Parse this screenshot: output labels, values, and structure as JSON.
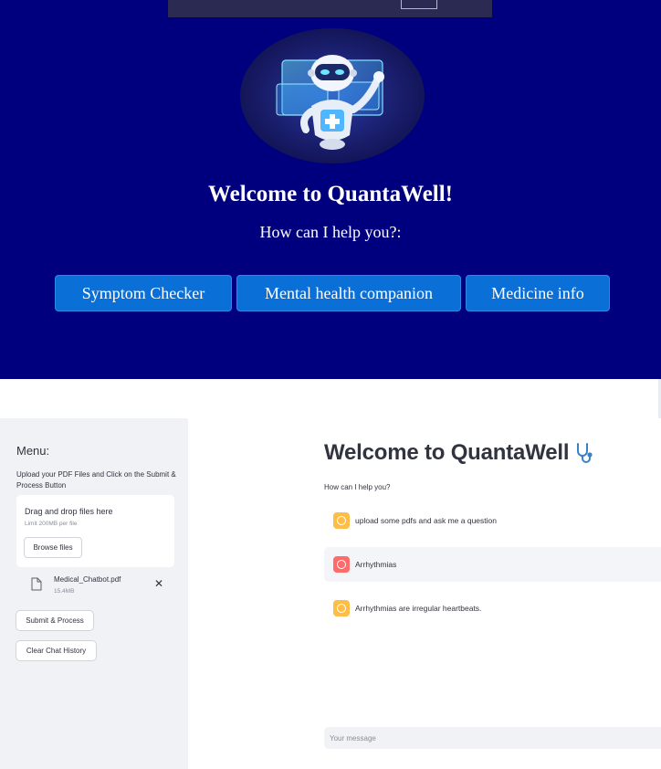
{
  "hero": {
    "title": "Welcome to QuantaWell!",
    "subtitle": "How can I help you?:",
    "buttons": [
      {
        "label": "Symptom Checker"
      },
      {
        "label": "Mental health companion"
      },
      {
        "label": "Medicine info"
      }
    ],
    "colors": {
      "background": "#00007f",
      "button": "#0b6fd8"
    }
  },
  "sidebar": {
    "menu_title": "Menu:",
    "description": "Upload your PDF Files and Click on the Submit & Process Button",
    "uploader": {
      "title": "Drag and drop files here",
      "limit": "Limit 200MB per file",
      "browse_label": "Browse files"
    },
    "file": {
      "name": "Medical_Chatbot.pdf",
      "size": "15.4MB",
      "remove_icon": "close-icon"
    },
    "submit_label": "Submit & Process",
    "clear_label": "Clear Chat History"
  },
  "chat": {
    "title": "Welcome to QuantaWell",
    "title_icon": "stethoscope-icon",
    "subtitle": "How can I help you?",
    "messages": [
      {
        "role": "assistant",
        "text": "upload some pdfs and ask me a question"
      },
      {
        "role": "user",
        "text": "Arrhythmias"
      },
      {
        "role": "assistant",
        "text": "Arrhythmias are irregular heartbeats."
      }
    ],
    "input_placeholder": "Your message",
    "colors": {
      "assistant_avatar": "#ffbd45",
      "user_avatar": "#ff6b6b"
    }
  }
}
